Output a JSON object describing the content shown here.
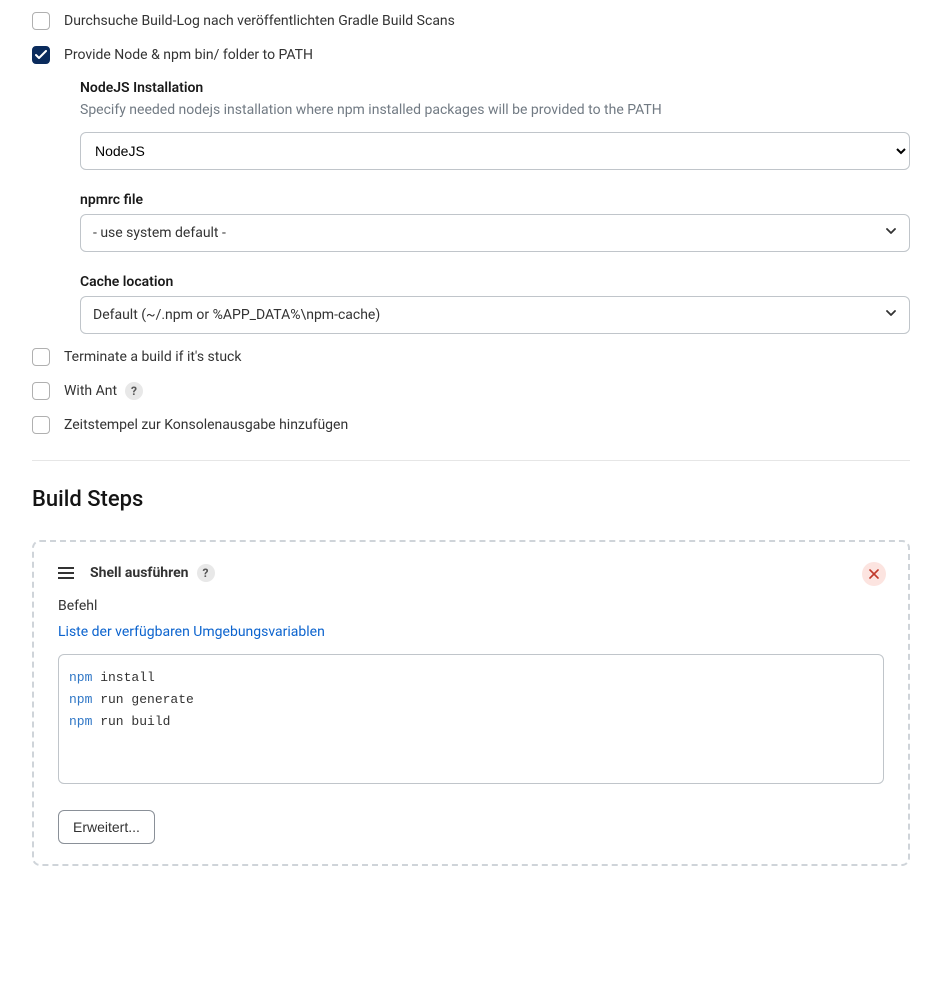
{
  "buildEnv": {
    "gradleScan": {
      "checked": false,
      "label": "Durchsuche Build-Log nach veröffentlichten Gradle Build Scans"
    },
    "nodeNpm": {
      "checked": true,
      "label": "Provide Node & npm bin/ folder to PATH",
      "nodejsInstall": {
        "label": "NodeJS Installation",
        "help": "Specify needed nodejs installation where npm installed packages will be provided to the PATH",
        "value": "NodeJS"
      },
      "npmrc": {
        "label": "npmrc file",
        "value": "- use system default -"
      },
      "cache": {
        "label": "Cache location",
        "value": "Default (~/.npm or %APP_DATA%\\npm-cache)"
      }
    },
    "terminateStuck": {
      "checked": false,
      "label": "Terminate a build if it's stuck"
    },
    "withAnt": {
      "checked": false,
      "label": "With Ant",
      "help": "?"
    },
    "timestamps": {
      "checked": false,
      "label": "Zeitstempel zur Konsolenausgabe hinzufügen"
    }
  },
  "buildStepsSection": {
    "title": "Build Steps"
  },
  "shellStep": {
    "title": "Shell ausführen",
    "help": "?",
    "commandLabel": "Befehl",
    "envVarsLink": "Liste der verfügbaren Umgebungsvariablen",
    "script": {
      "lines": [
        {
          "cmd": "npm",
          "args": "install"
        },
        {
          "cmd": "npm",
          "args": "run generate"
        },
        {
          "cmd": "npm",
          "args": "run build"
        }
      ]
    },
    "advancedBtn": "Erweitert..."
  }
}
